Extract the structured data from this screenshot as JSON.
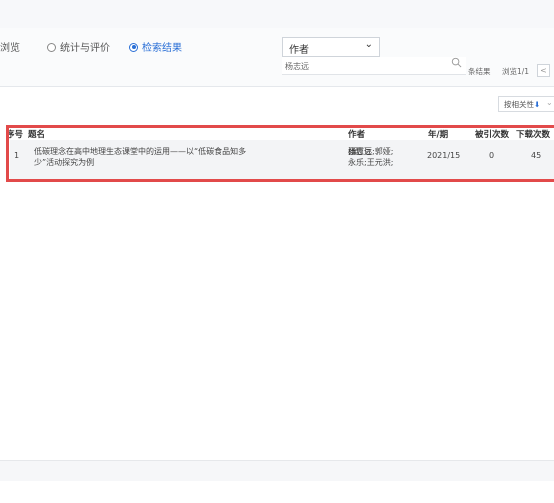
{
  "tabs": [
    {
      "label": "浏览",
      "active": false,
      "radio": false
    },
    {
      "label": "统计与评价",
      "active": false,
      "radio": true
    },
    {
      "label": "检索结果",
      "active": true,
      "radio": true
    }
  ],
  "search": {
    "field_value": "作者",
    "query_value": "杨志远"
  },
  "result_info": "条结果",
  "page_info": "浏览1/1",
  "prev_label": "<",
  "sort": {
    "label": "按相关性",
    "arrow": "⬇"
  },
  "table": {
    "headers": {
      "index": "序号",
      "title": "题名",
      "author": "作者",
      "year_issue": "年/期",
      "cited": "被引次数",
      "downloads": "下载次数"
    },
    "rows": [
      {
        "index": "1",
        "title_line1": "低碳理念在高中地理生态课堂中的运用——以“低碳食品知多",
        "title_line2": "少”活动探究为例",
        "author_before": "张豆豆;郭娅;",
        "author_highlight": "杨志远",
        "author_after": ";吴",
        "author_line2": "永乐;王元洪;",
        "year_issue": "2021/15",
        "cited": "0",
        "downloads": "45"
      }
    ]
  },
  "colors": {
    "highlight_frame": "#e24a4a",
    "accent": "#2a6fd6",
    "author_highlight": "#e02020"
  }
}
